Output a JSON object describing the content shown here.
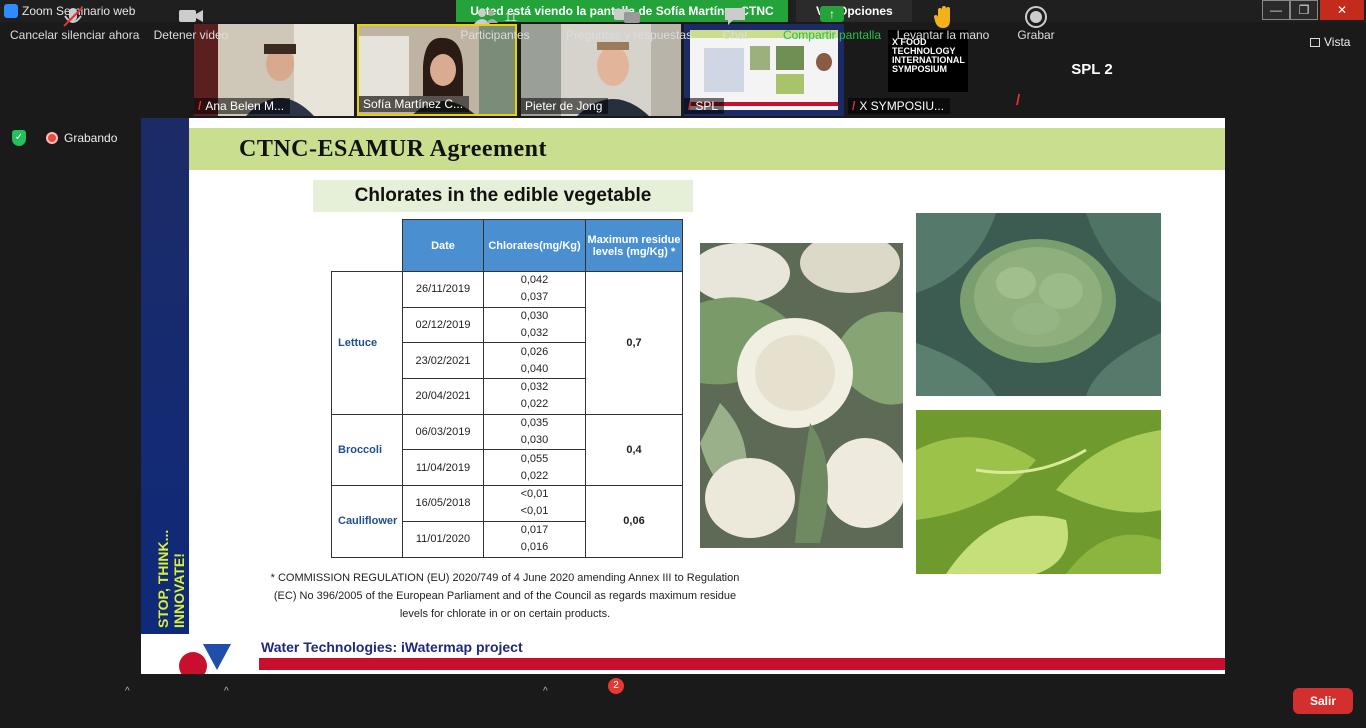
{
  "window": {
    "title": "Zoom Seminario web",
    "share_banner": "Usted está viendo la pantalla de Sofía Martínez CTNC",
    "view_options": "Ver Opciones",
    "view_icon": "chevron-down-icon",
    "minimize": "—",
    "maximize": "❐",
    "close": "✕"
  },
  "participants": [
    {
      "name": "Ana Belen M...",
      "muted": true
    },
    {
      "name": "Sofía Martínez C...",
      "muted": false,
      "active": true
    },
    {
      "name": "Pieter de Jong",
      "muted": false
    },
    {
      "name": "SPL",
      "muted": true
    },
    {
      "name": "X SYMPOSIU...",
      "muted": true
    },
    {
      "name": "SPL 2",
      "muted": true
    }
  ],
  "symposium_logo": "X FOOD TECHNOLOGY INTERNATIONAL SYMPOSIUM",
  "vista_label": "Vista",
  "recording_label": "Grabando",
  "slide": {
    "title": "CTNC-ESAMUR Agreement",
    "subtitle": "Chlorates in the edible vegetable",
    "headers": {
      "date": "Date",
      "chlorates": "Chlorates(mg/Kg)",
      "mrl": "Maximum residue levels (mg/Kg) *"
    },
    "groups": [
      {
        "product": "Lettuce",
        "mrl": "0,7",
        "rows": [
          {
            "date": "26/11/2019",
            "v1": "0,042",
            "v2": "0,037"
          },
          {
            "date": "02/12/2019",
            "v1": "0,030",
            "v2": "0,032"
          },
          {
            "date": "23/02/2021",
            "v1": "0,026",
            "v2": "0,040"
          },
          {
            "date": "20/04/2021",
            "v1": "0,032",
            "v2": "0,022"
          }
        ]
      },
      {
        "product": "Broccoli",
        "mrl": "0,4",
        "rows": [
          {
            "date": "06/03/2019",
            "v1": "0,035",
            "v2": "0,030"
          },
          {
            "date": "11/04/2019",
            "v1": "0,055",
            "v2": "0,022"
          }
        ]
      },
      {
        "product": "Cauliflower",
        "mrl": "0,06",
        "rows": [
          {
            "date": "16/05/2018",
            "v1": "<0,01",
            "v2": "<0,01"
          },
          {
            "date": "11/01/2020",
            "v1": "0,017",
            "v2": "0,016"
          }
        ]
      }
    ],
    "footnote": "*  COMMISSION REGULATION (EU) 2020/749 of 4 June 2020 amending Annex III to Regulation (EC) No 396/2005 of the European Parliament and of the Council as regards maximum residue levels for chlorate in or on certain products.",
    "side_text_1": "STOP, THINK...",
    "side_text_2": "INNOVATE!",
    "bottom_text": "Water Technologies: iWatermap project"
  },
  "toolbar": {
    "unmute": "Cancelar silenciar ahora",
    "stop_video": "Detener video",
    "participants": "Participantes",
    "participants_count": "11",
    "qa": "Preguntas y respuestas",
    "qa_badge": "2",
    "chat": "Chat",
    "share": "Compartir pantalla",
    "raise_hand": "Levantar la mano",
    "record": "Grabar",
    "exit": "Salir"
  },
  "colors": {
    "share_green": "#23a33a",
    "exit_red": "#d32f2f",
    "table_header": "#4a90d0",
    "slide_band": "#c9df8f"
  }
}
